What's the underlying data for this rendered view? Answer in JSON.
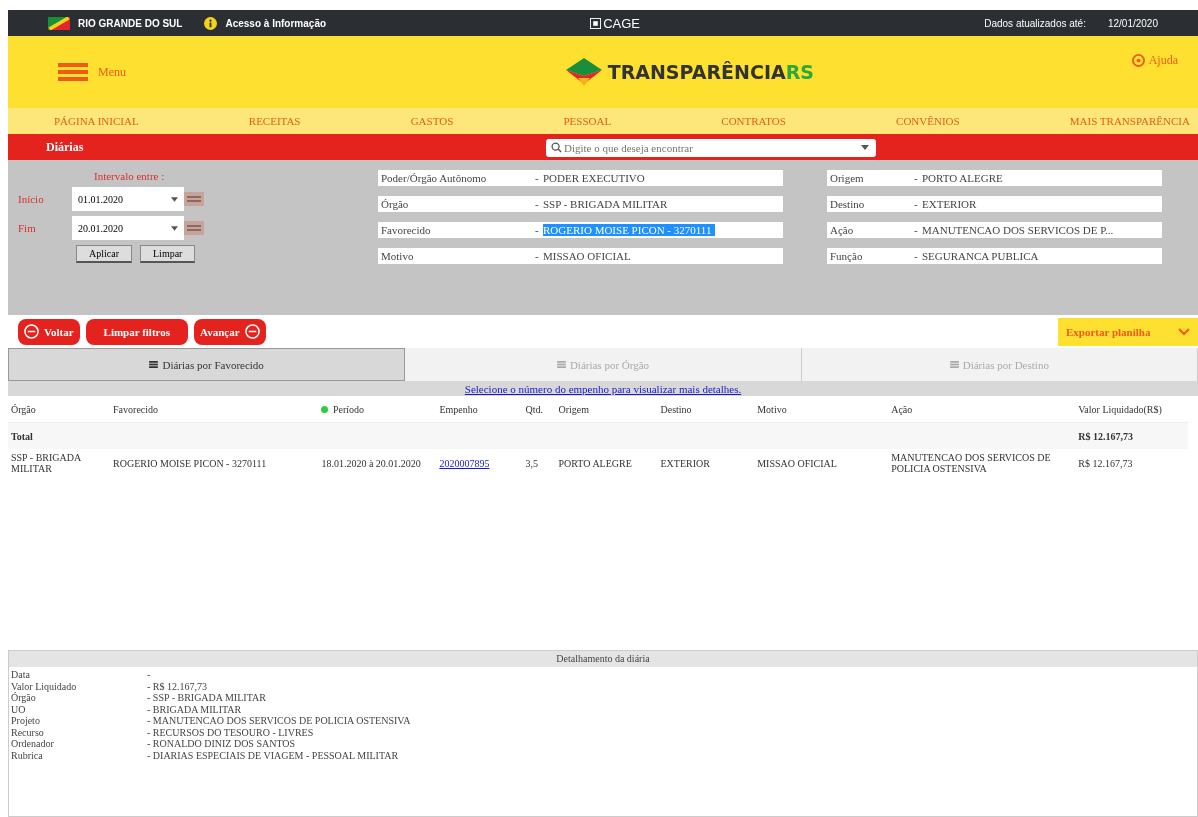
{
  "top_bar": {
    "state": "RIO GRANDE DO SUL",
    "access": "Acesso à Informação",
    "cage": "CAGE",
    "updated_label": "Dados atualizados até:",
    "updated_date": "12/01/2020"
  },
  "header": {
    "menu": "Menu",
    "logo_main": "TRANSPARÊNCIA",
    "logo_suffix": "RS",
    "help": "Ajuda"
  },
  "nav": [
    "PÁGINA INICIAL",
    "RECEITAS",
    "GASTOS",
    "PESSOAL",
    "CONTRATOS",
    "CONVÊNIOS",
    "MAIS TRANSPARÊNCIA"
  ],
  "section": {
    "title": "Diárias",
    "search_placeholder": "Digite o que deseja encontrar"
  },
  "date_filter": {
    "legend": "Intervalo entre :",
    "start_label": "Início",
    "start": "01.01.2020",
    "end_label": "Fim",
    "end": "20.01.2020",
    "apply": "Aplicar",
    "clear": "Limpar"
  },
  "filters_left": [
    {
      "label": "Poder/Órgão Autônomo",
      "separator": "-",
      "value": "PODER EXECUTIVO",
      "selected": false
    },
    {
      "label": "Órgão",
      "separator": "-",
      "value": "SSP - BRIGADA MILITAR",
      "selected": false
    },
    {
      "label": "Favorecido",
      "separator": "-",
      "value": "ROGERIO MOISE PICON - 3270111",
      "selected": true
    },
    {
      "label": "Motivo",
      "separator": "-",
      "value": "MISSAO OFICIAL",
      "selected": false
    }
  ],
  "filters_right": [
    {
      "label": "Origem",
      "separator": "-",
      "value": "PORTO ALEGRE",
      "selected": false
    },
    {
      "label": "Destino",
      "separator": "-",
      "value": "EXTERIOR",
      "selected": false
    },
    {
      "label": "Ação",
      "separator": "-",
      "value": "MANUTENCAO DOS SERVICOS DE P...",
      "selected": false
    },
    {
      "label": "Função",
      "separator": "-",
      "value": "SEGURANCA PUBLICA",
      "selected": false
    }
  ],
  "actions": {
    "back": "Voltar",
    "clear_filters": "Limpar filtros",
    "forward": "Avançar",
    "export": "Exportar planilha"
  },
  "tabs": [
    {
      "label": "Diárias por Favorecido",
      "selected": true
    },
    {
      "label": "Diárias por Órgão",
      "selected": false
    },
    {
      "label": "Diárias por Destino",
      "selected": false
    }
  ],
  "hint_link": "Selecione o número do empenho para visualizar mais detalhes.",
  "table": {
    "columns": [
      "Órgão",
      "Favorecido",
      "Período",
      "Empenho",
      "Qtd.",
      "Origem",
      "Destino",
      "Motivo",
      "Ação",
      "Valor Liquidado(R$)"
    ],
    "total": {
      "label": "Total",
      "value": "R$ 12.167,73"
    },
    "rows": [
      [
        "SSP - BRIGADA MILITAR",
        "ROGERIO MOISE PICON - 3270111",
        "18.01.2020 à 20.01.2020",
        "2020007895",
        "3,5",
        "PORTO ALEGRE",
        "EXTERIOR",
        "MISSAO OFICIAL",
        "MANUTENCAO DOS SERVICOS DE POLICIA OSTENSIVA",
        "R$ 12.167,73"
      ]
    ]
  },
  "details": {
    "title": "Detalhamento da diária",
    "items": [
      {
        "label": "Data",
        "value": "-"
      },
      {
        "label": "Valor Liquidado",
        "value": "- R$ 12.167,73"
      },
      {
        "label": "Órgão",
        "value": "- SSP - BRIGADA MILITAR"
      },
      {
        "label": "UO",
        "value": "- BRIGADA MILITAR"
      },
      {
        "label": "Projeto",
        "value": "- MANUTENCAO DOS SERVICOS DE POLICIA OSTENSIVA"
      },
      {
        "label": "Recurso",
        "value": "- RECURSOS DO TESOURO - LIVRES"
      },
      {
        "label": "Ordenador",
        "value": "- RONALDO DINIZ DOS SANTOS"
      },
      {
        "label": "Rubrica",
        "value": "- DIARIAS ESPECIAIS DE VIAGEM - PESSOAL MILITAR"
      }
    ]
  }
}
